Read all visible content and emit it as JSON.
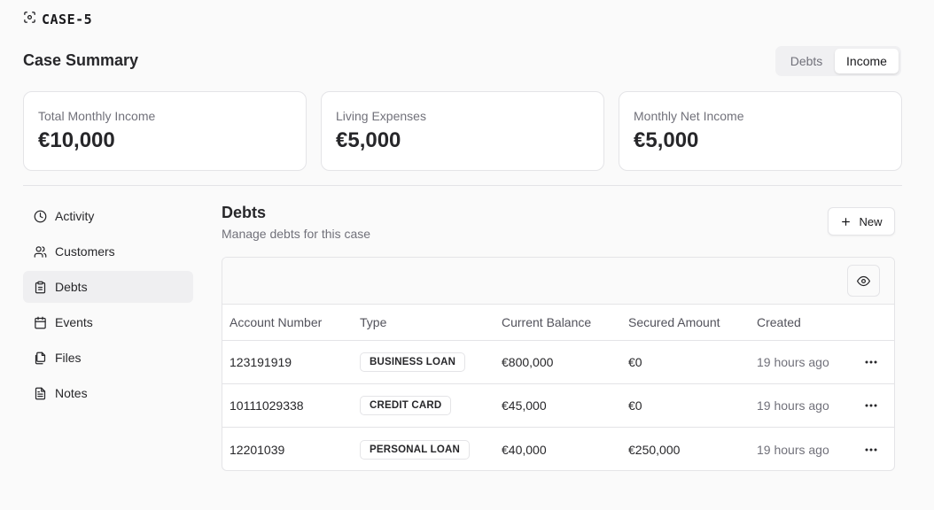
{
  "app": {
    "case_id": "CASE-5",
    "logo_icon": "scan-icon"
  },
  "header": {
    "title": "Case Summary",
    "toggle": {
      "options": [
        "Debts",
        "Income"
      ],
      "selected": "Income"
    }
  },
  "summary_cards": [
    {
      "label": "Total Monthly Income",
      "value": "€10,000"
    },
    {
      "label": "Living Expenses",
      "value": "€5,000"
    },
    {
      "label": "Monthly Net Income",
      "value": "€5,000"
    }
  ],
  "sidebar": {
    "active": "Debts",
    "items": [
      {
        "label": "Activity",
        "icon": "clock-icon"
      },
      {
        "label": "Customers",
        "icon": "users-icon"
      },
      {
        "label": "Debts",
        "icon": "clipboard-icon"
      },
      {
        "label": "Events",
        "icon": "calendar-icon"
      },
      {
        "label": "Files",
        "icon": "files-icon"
      },
      {
        "label": "Notes",
        "icon": "notes-icon"
      }
    ]
  },
  "section": {
    "title": "Debts",
    "subtitle": "Manage debts for this case",
    "new_label": "New"
  },
  "table": {
    "columns": [
      "Account Number",
      "Type",
      "Current Balance",
      "Secured Amount",
      "Created"
    ],
    "rows": [
      {
        "account": "123191919",
        "type": "BUSINESS LOAN",
        "balance": "€800,000",
        "secured": "€0",
        "created": "19 hours ago"
      },
      {
        "account": "10111029338",
        "type": "CREDIT CARD",
        "balance": "€45,000",
        "secured": "€0",
        "created": "19 hours ago"
      },
      {
        "account": "12201039",
        "type": "PERSONAL LOAN",
        "balance": "€40,000",
        "secured": "€250,000",
        "created": "19 hours ago"
      }
    ]
  }
}
